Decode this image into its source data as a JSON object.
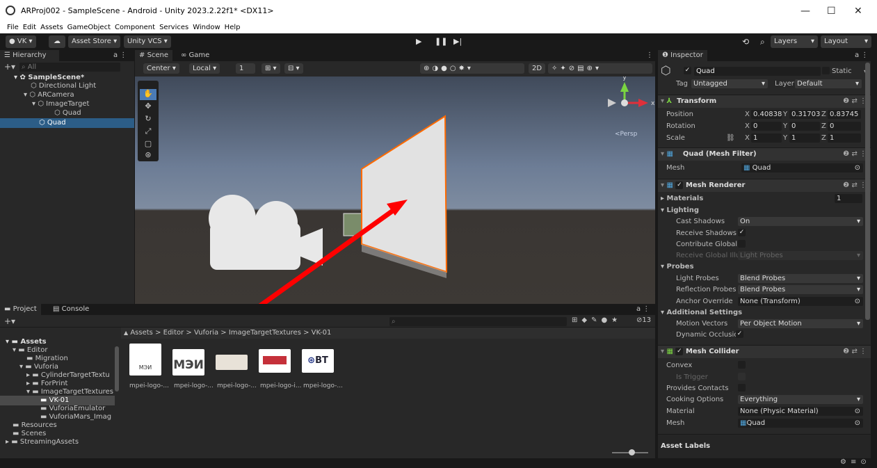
{
  "window": {
    "title": "ARProj002 - SampleScene - Android - Unity 2023.2.22f1* <DX11>",
    "minimize": "—",
    "maximize": "☐",
    "close": "✕"
  },
  "menu": [
    "File",
    "Edit",
    "Assets",
    "GameObject",
    "Component",
    "Services",
    "Window",
    "Help"
  ],
  "toolbar": {
    "account": "VK ▾",
    "asset_store": "Asset Store ▾",
    "vcs": "Unity VCS ▾",
    "layers": "Layers",
    "layout": "Layout"
  },
  "hierarchy": {
    "tab": "Hierarchy",
    "search_placeholder": "All",
    "items": [
      "SampleScene*",
      "Directional Light",
      "ARCamera",
      "ImageTarget",
      "Quad",
      "Quad"
    ]
  },
  "scene": {
    "tab_scene": "Scene",
    "tab_game": "Game",
    "center": "Center ▾",
    "local": "Local ▾",
    "grid_size": "1",
    "mode_2d": "2D",
    "persp": "<Persp"
  },
  "project": {
    "tab_project": "Project",
    "tab_console": "Console",
    "breadcrumb": "Assets > Editor > Vuforia > ImageTargetTextures > VK-01",
    "hidden_count": "13",
    "tree": [
      "Assets",
      "Editor",
      "Migration",
      "Vuforia",
      "CylinderTargetTextu",
      "ForPrint",
      "ImageTargetTextures",
      "VK-01",
      "VuforiaEmulator",
      "VuforiaMars_Imag",
      "Resources",
      "Scenes",
      "StreamingAssets"
    ],
    "thumbs": [
      "mpei-logo-...",
      "mpei-logo-...",
      "mpei-logo-...",
      "mpei-logo-i...",
      "mpei-logo-..."
    ],
    "thumb_text": [
      "МЭИ",
      "МЭИ",
      "",
      "",
      "ВТ"
    ]
  },
  "inspector": {
    "tab": "Inspector",
    "object_name": "Quad",
    "static": "Static",
    "tag_label": "Tag",
    "tag": "Untagged",
    "layer_label": "Layer",
    "layer": "Default",
    "transform": {
      "title": "Transform",
      "position_label": "Position",
      "rotation_label": "Rotation",
      "scale_label": "Scale",
      "pos": [
        "X",
        "0.40838",
        "Y",
        "0.31703(",
        "Z",
        "0.83745"
      ],
      "rot": [
        "X",
        "0",
        "Y",
        "0",
        "Z",
        "0"
      ],
      "scale": [
        "X",
        "1",
        "Y",
        "1",
        "Z",
        "1"
      ]
    },
    "mesh_filter": {
      "title": "Quad (Mesh Filter)",
      "mesh_label": "Mesh",
      "mesh": "Quad"
    },
    "mesh_renderer": {
      "title": "Mesh Renderer",
      "materials": "Materials",
      "materials_count": "1",
      "lighting": "Lighting",
      "cast_shadows_label": "Cast Shadows",
      "cast_shadows": "On",
      "receive_shadows_label": "Receive Shadows",
      "contribute_gi_label": "Contribute Global I",
      "receive_gi_label": "Receive Global Illur",
      "receive_gi": "Light Probes",
      "probes": "Probes",
      "light_probes_label": "Light Probes",
      "light_probes": "Blend Probes",
      "reflection_probes_label": "Reflection Probes",
      "reflection_probes": "Blend Probes",
      "anchor_label": "Anchor Override",
      "anchor": "None (Transform)",
      "additional": "Additional Settings",
      "motion_vectors_label": "Motion Vectors",
      "motion_vectors": "Per Object Motion",
      "dynamic_occlusion_label": "Dynamic Occlusion"
    },
    "mesh_collider": {
      "title": "Mesh Collider",
      "convex": "Convex",
      "is_trigger": "Is Trigger",
      "provides_contacts": "Provides Contacts",
      "cooking_label": "Cooking Options",
      "cooking": "Everything",
      "material_label": "Material",
      "material": "None (Physic Material)",
      "mesh_label": "Mesh",
      "mesh": "Quad"
    },
    "asset_labels": "Asset Labels"
  },
  "colors": {
    "selection": "#2c5d87",
    "arrow": "#ff0000",
    "quad_outline": "#ff6a00",
    "sky": "#6d7d96",
    "ground": "#3a3633"
  }
}
